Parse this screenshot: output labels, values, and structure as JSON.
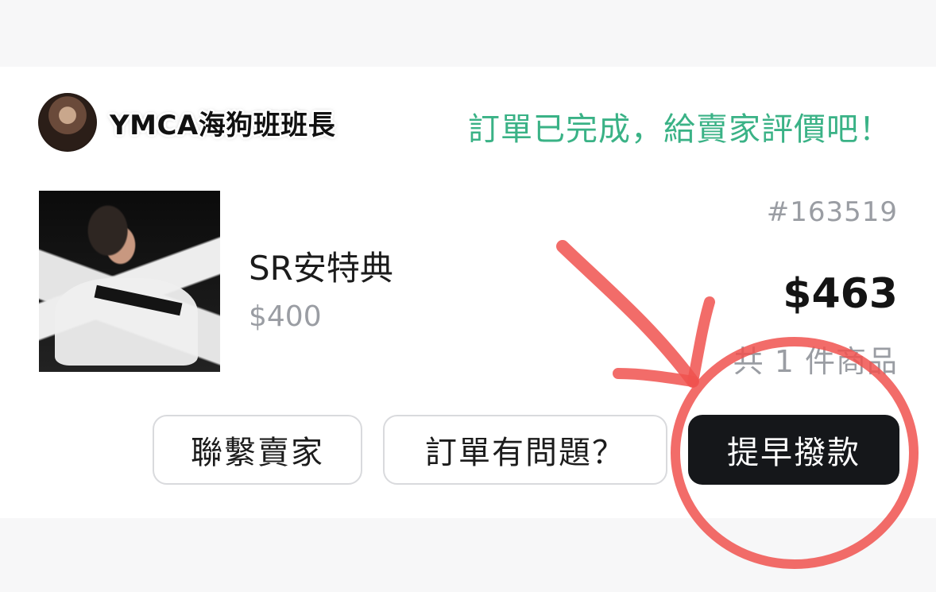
{
  "seller": {
    "name": "YMCA海狗班班長",
    "status": "訂單已完成，給賣家評價吧！"
  },
  "order": {
    "id": "#163519",
    "total": "$463",
    "item_count": "共 1 件商品"
  },
  "product": {
    "name": "SR安特典",
    "price": "$400"
  },
  "actions": {
    "contact_seller": "聯繫賣家",
    "order_issue": "訂單有問題？",
    "early_release": "提早撥款"
  },
  "colors": {
    "status_green": "#3ab286",
    "primary_button": "#15171a",
    "muted_text": "#9a9da3",
    "annotation_red": "#f0524f"
  }
}
